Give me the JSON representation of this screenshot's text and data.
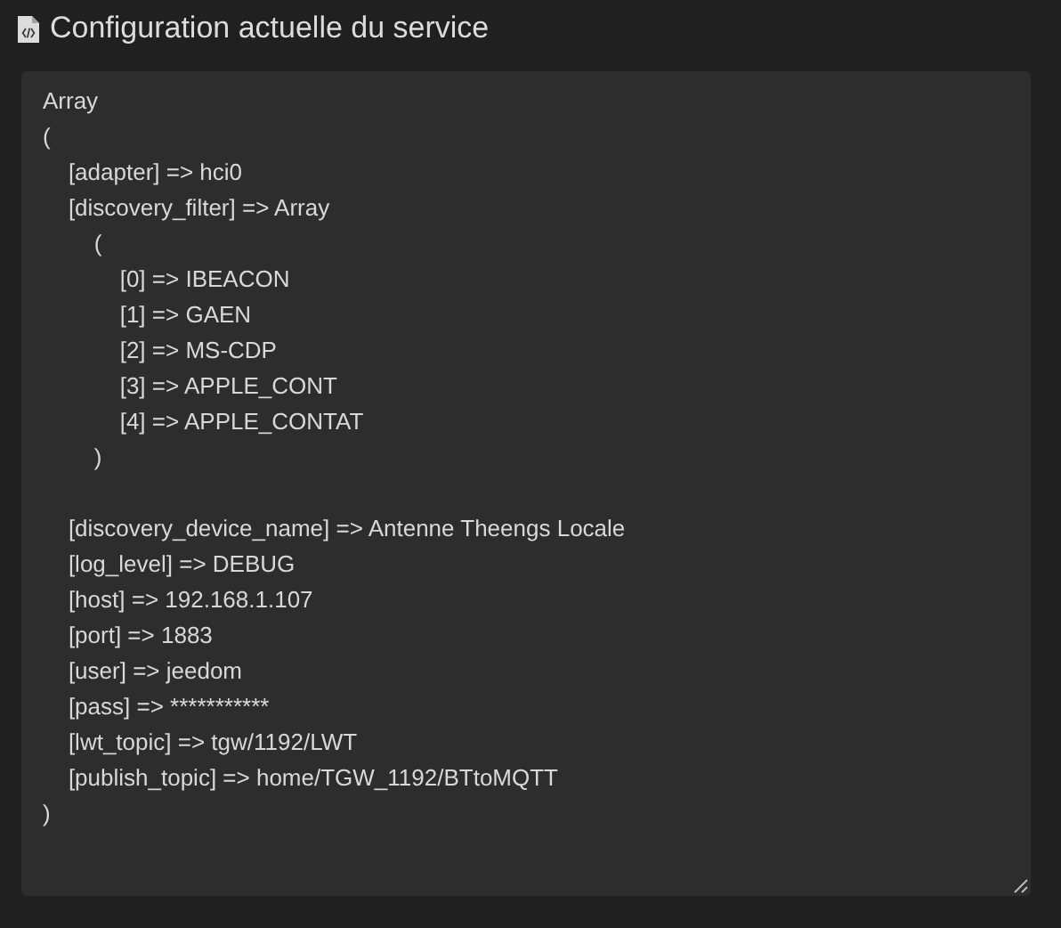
{
  "title": "Configuration actuelle du service",
  "config": {
    "value": "Array\n(\n    [adapter] => hci0\n    [discovery_filter] => Array\n        (\n            [0] => IBEACON\n            [1] => GAEN\n            [2] => MS-CDP\n            [3] => APPLE_CONT\n            [4] => APPLE_CONTAT\n        )\n\n    [discovery_device_name] => Antenne Theengs Locale\n    [log_level] => DEBUG\n    [host] => 192.168.1.107\n    [port] => 1883\n    [user] => jeedom\n    [pass] => ***********\n    [lwt_topic] => tgw/1192/LWT\n    [publish_topic] => home/TGW_1192/BTtoMQTT\n)"
  }
}
